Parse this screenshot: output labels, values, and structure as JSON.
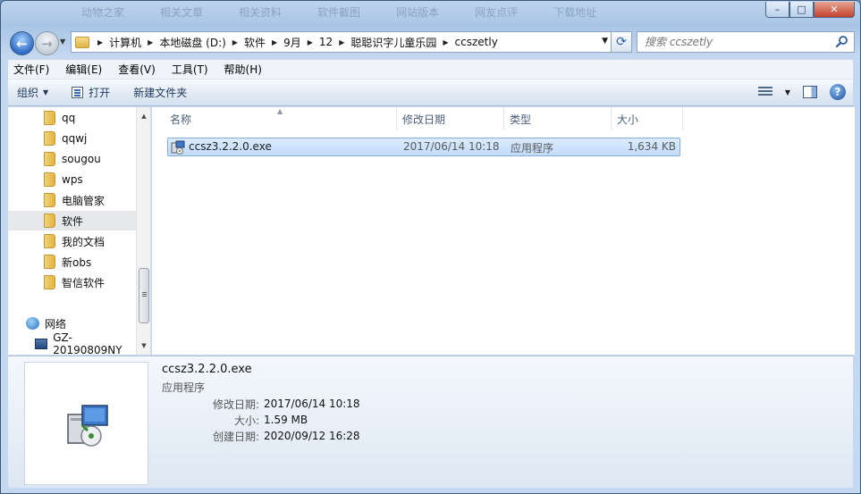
{
  "window": {
    "background_tabs": [
      "动物之家",
      "相关文章",
      "相关资料",
      "软件截图",
      "网站版本",
      "网友点评",
      "下载地址"
    ],
    "caption": {
      "minimize": "–",
      "maximize": "□",
      "close": "✕"
    }
  },
  "address": {
    "crumbs": [
      "计算机",
      "本地磁盘 (D:)",
      "软件",
      "9月",
      "12",
      "聪聪识字儿童乐园",
      "ccszetly"
    ],
    "search_placeholder": "搜索 ccszetly"
  },
  "menubar": [
    "文件(F)",
    "编辑(E)",
    "查看(V)",
    "工具(T)",
    "帮助(H)"
  ],
  "toolbar": {
    "organize": "组织",
    "open": "打开",
    "new_folder": "新建文件夹"
  },
  "nav": {
    "folders": [
      "qq",
      "qqwj",
      "sougou",
      "wps",
      "电脑管家",
      "软件",
      "我的文档",
      "新obs",
      "智信软件"
    ],
    "selected": "软件",
    "network": "网络",
    "computer": "GZ-20190809NY"
  },
  "columns": {
    "name": "名称",
    "modified": "修改日期",
    "type": "类型",
    "size": "大小"
  },
  "files": [
    {
      "name": "ccsz3.2.2.0.exe",
      "modified": "2017/06/14 10:18",
      "type": "应用程序",
      "size": "1,634 KB"
    }
  ],
  "details": {
    "name": "ccsz3.2.2.0.exe",
    "type": "应用程序",
    "modified_label": "修改日期:",
    "modified": "2017/06/14 10:18",
    "size_label": "大小:",
    "size": "1.59 MB",
    "created_label": "创建日期:",
    "created": "2020/09/12 16:28"
  },
  "colors": {
    "selection": "#cce2fc",
    "accent": "#2f6bc2"
  },
  "icons": [
    "back-arrow-icon",
    "forward-arrow-icon",
    "folder-icon",
    "refresh-icon",
    "search-icon",
    "open-icon",
    "views-icon",
    "preview-pane-icon",
    "help-icon",
    "network-icon",
    "computer-icon",
    "installer-icon"
  ]
}
